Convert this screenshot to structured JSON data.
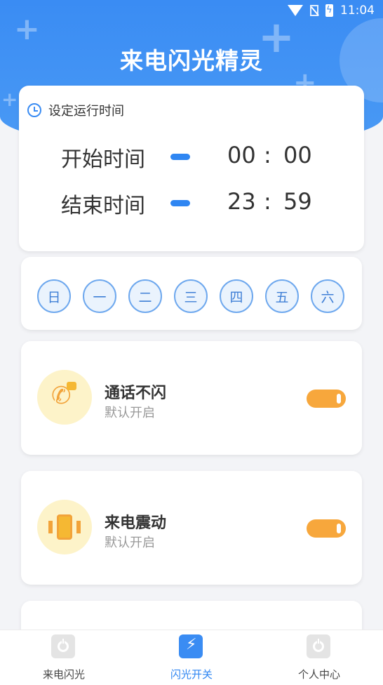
{
  "status_bar": {
    "time": "11:04",
    "icons": [
      "wifi-icon",
      "no-sim-icon",
      "battery-charging-icon"
    ]
  },
  "app": {
    "title": "来电闪光精灵"
  },
  "schedule": {
    "heading": "设定运行时间",
    "start": {
      "label": "开始时间",
      "hour": "00",
      "separator": ":",
      "minute": "00"
    },
    "end": {
      "label": "结束时间",
      "hour": "23",
      "separator": ":",
      "minute": "59"
    }
  },
  "weekdays": [
    "日",
    "一",
    "二",
    "三",
    "四",
    "五",
    "六"
  ],
  "features": [
    {
      "title": "通话不闪",
      "subtitle": "默认开启",
      "icon": "phone-chat-icon",
      "enabled": true
    },
    {
      "title": "来电震动",
      "subtitle": "默认开启",
      "icon": "vibrate-phone-icon",
      "enabled": true
    }
  ],
  "tabs": [
    {
      "label": "来电闪光",
      "icon": "power-icon",
      "active": false
    },
    {
      "label": "闪光开关",
      "icon": "flash-icon",
      "active": true
    },
    {
      "label": "个人中心",
      "icon": "power-icon",
      "active": false
    }
  ],
  "colors": {
    "primary": "#3a8cf3",
    "accent_orange": "#f7a73c",
    "icon_bg": "#fdf3c9"
  }
}
